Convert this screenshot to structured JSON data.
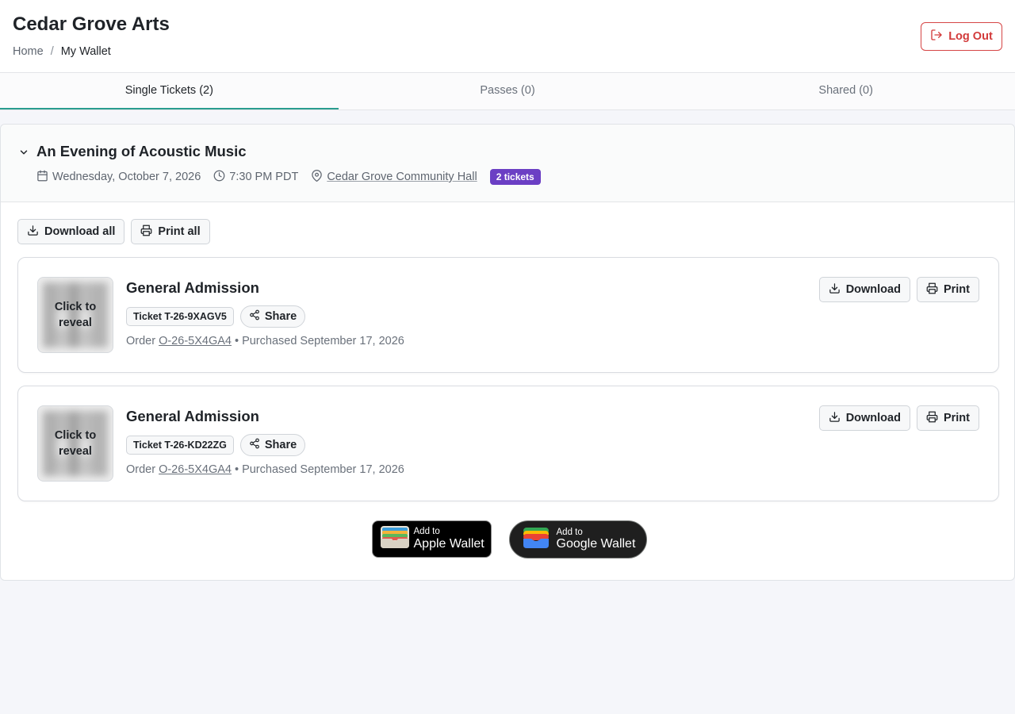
{
  "header": {
    "app_title": "Cedar Grove Arts",
    "breadcrumb": {
      "home": "Home",
      "separator": "/",
      "current": "My Wallet"
    },
    "logout_label": "Log Out"
  },
  "tabs": [
    {
      "label": "Single Tickets (2)",
      "active": true
    },
    {
      "label": "Passes (0)",
      "active": false
    },
    {
      "label": "Shared (0)",
      "active": false
    }
  ],
  "event": {
    "title": "An Evening of Acoustic Music",
    "date": "Wednesday, October 7, 2026",
    "time": "7:30 PM PDT",
    "venue": "Cedar Grove Community Hall",
    "ticket_count_badge": "2 tickets",
    "download_all_label": "Download all",
    "print_all_label": "Print all"
  },
  "tickets": [
    {
      "reveal_label": "Click to reveal",
      "title": "General Admission",
      "ticket_id": "Ticket T-26-9XAGV5",
      "share_label": "Share",
      "order_prefix": "Order",
      "order_id": "O-26-5X4GA4",
      "purchased": "• Purchased September 17, 2026",
      "download_label": "Download",
      "print_label": "Print"
    },
    {
      "reveal_label": "Click to reveal",
      "title": "General Admission",
      "ticket_id": "Ticket T-26-KD22ZG",
      "share_label": "Share",
      "order_prefix": "Order",
      "order_id": "O-26-5X4GA4",
      "purchased": "• Purchased September 17, 2026",
      "download_label": "Download",
      "print_label": "Print"
    }
  ],
  "wallets": {
    "apple": {
      "small": "Add to",
      "big": "Apple Wallet"
    },
    "google": {
      "small": "Add to",
      "big": "Google Wallet"
    }
  },
  "colors": {
    "accent_tab": "#2a9d8f",
    "logout": "#d23a3a",
    "badge": "#6b3fc4"
  },
  "icons": {
    "logout": "logout-icon",
    "chevron": "chevron-down-icon",
    "calendar": "calendar-icon",
    "clock": "clock-icon",
    "location": "map-pin-icon",
    "download": "download-icon",
    "print": "printer-icon",
    "share": "share-icon"
  }
}
